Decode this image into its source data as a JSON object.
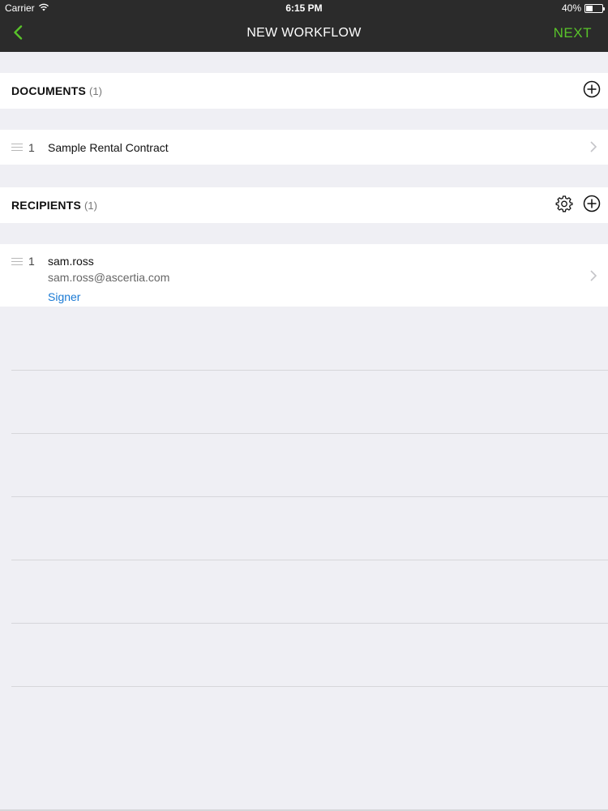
{
  "status": {
    "carrier": "Carrier",
    "time": "6:15 PM",
    "battery_text": "40%",
    "battery_level": 0.4
  },
  "nav": {
    "title": "NEW WORKFLOW",
    "next_label": "NEXT",
    "accent_color": "#59c32a"
  },
  "documents": {
    "title": "DOCUMENTS",
    "count": "(1)",
    "items": [
      {
        "index": "1",
        "name": "Sample Rental Contract"
      }
    ]
  },
  "recipients": {
    "title": "RECIPIENTS",
    "count": "(1)",
    "items": [
      {
        "index": "1",
        "name": "sam.ross",
        "email": "sam.ross@ascertia.com",
        "role": "Signer"
      }
    ]
  },
  "icons": {
    "back": "chevron-left-icon",
    "add": "plus-circle-icon",
    "settings": "gear-icon",
    "disclosure": "chevron-right-icon",
    "reorder": "reorder-handle-icon"
  }
}
